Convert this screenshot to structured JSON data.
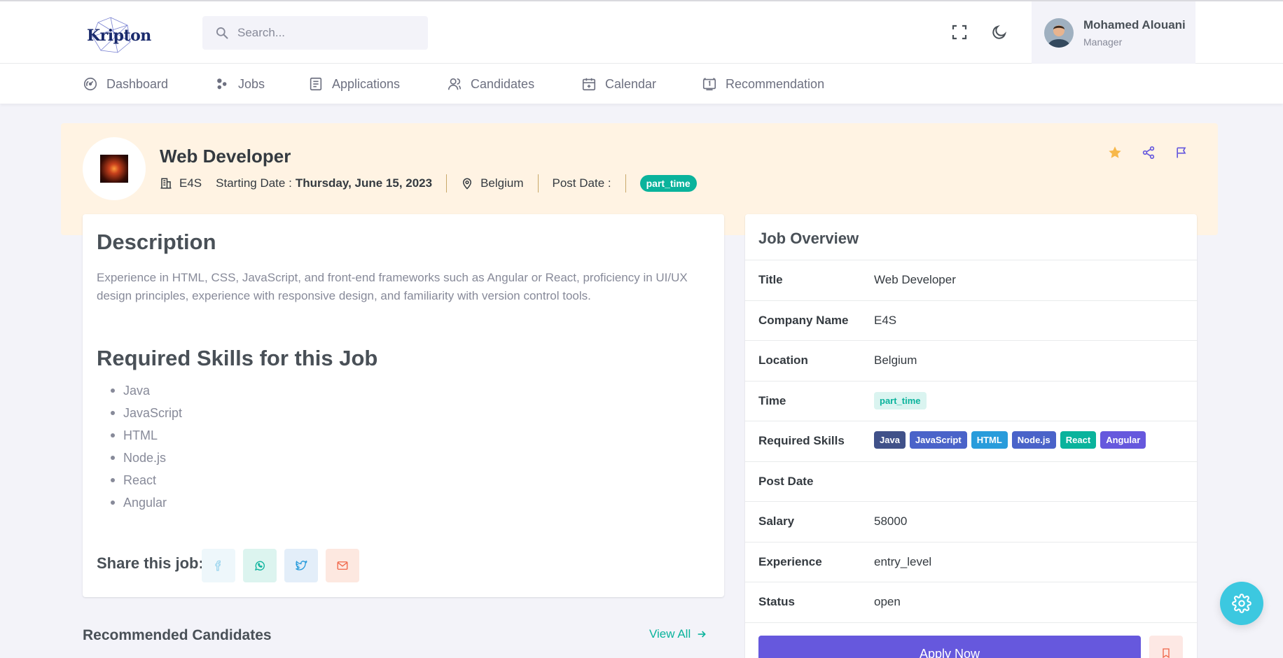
{
  "header": {
    "logo_text": "Kripton",
    "search_placeholder": "Search...",
    "user": {
      "name": "Mohamed Alouani",
      "role": "Manager"
    }
  },
  "nav": {
    "items": [
      {
        "label": "Dashboard",
        "icon": "dashboard-icon"
      },
      {
        "label": "Jobs",
        "icon": "jobs-icon"
      },
      {
        "label": "Applications",
        "icon": "applications-icon"
      },
      {
        "label": "Candidates",
        "icon": "candidates-icon"
      },
      {
        "label": "Calendar",
        "icon": "calendar-icon"
      },
      {
        "label": "Recommendation",
        "icon": "recommendation-icon"
      }
    ]
  },
  "job": {
    "title": "Web Developer",
    "company": "E4S",
    "starting_date_label": "Starting Date :",
    "starting_date": "Thursday, June 15, 2023",
    "location": "Belgium",
    "post_date_label": "Post Date :",
    "type": "part_time"
  },
  "description": {
    "heading": "Description",
    "text": "Experience in HTML, CSS, JavaScript, and front-end frameworks such as Angular or React, proficiency in UI/UX design principles, experience with responsive design, and familiarity with version control tools.",
    "skills_heading": "Required Skills for this Job",
    "skills": [
      "Java",
      "JavaScript",
      "HTML",
      "Node.js",
      "React",
      "Angular"
    ],
    "share_label": "Share this job:"
  },
  "recommended": {
    "heading": "Recommended Candidates",
    "view_all": "View All"
  },
  "overview": {
    "heading": "Job Overview",
    "rows": {
      "title": {
        "label": "Title",
        "value": "Web Developer"
      },
      "company": {
        "label": "Company Name",
        "value": "E4S"
      },
      "location": {
        "label": "Location",
        "value": "Belgium"
      },
      "time": {
        "label": "Time",
        "value": "part_time"
      },
      "skills": {
        "label": "Required Skills",
        "values": [
          "Java",
          "JavaScript",
          "HTML",
          "Node.js",
          "React",
          "Angular"
        ]
      },
      "post_date": {
        "label": "Post Date",
        "value": ""
      },
      "salary": {
        "label": "Salary",
        "value": "58000"
      },
      "experience": {
        "label": "Experience",
        "value": "entry_level"
      },
      "status": {
        "label": "Status",
        "value": "open"
      }
    },
    "apply_label": "Apply Now"
  },
  "colors": {
    "primary": "#6658dd",
    "success": "#0ab39c",
    "info": "#299cdb",
    "hero_bg": "#fff3e3",
    "warning": "#f7b84b"
  }
}
